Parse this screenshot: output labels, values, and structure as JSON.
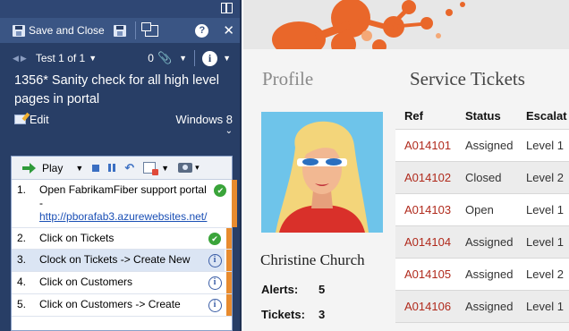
{
  "runner": {
    "toolbar": {
      "save_close_label": "Save and Close"
    },
    "nav": {
      "test_label": "Test 1 of 1",
      "attachment_count": "0"
    },
    "test_title": "1356* Sanity check for all high level pages in portal",
    "edit_label": "Edit",
    "configuration": "Windows 8",
    "play_label": "Play",
    "steps": [
      {
        "num": "1.",
        "text": "Open FabrikamFiber support portal  - ",
        "link": "http://pborafab3.azurewebsites.net/",
        "status": "passed",
        "selected": false
      },
      {
        "num": "2.",
        "text": "Click on Tickets",
        "status": "passed",
        "selected": false
      },
      {
        "num": "3.",
        "text": "Clock on Tickets -> Create New",
        "status": "info",
        "selected": true
      },
      {
        "num": "4.",
        "text": "Click on Customers",
        "status": "info",
        "selected": false
      },
      {
        "num": "5.",
        "text": "Click on Customers -> Create",
        "status": "info",
        "selected": false
      }
    ]
  },
  "web": {
    "profile_heading": "Profile",
    "person_name": "Christine Church",
    "stats": {
      "alerts_label": "Alerts:",
      "alerts_value": "5",
      "tickets_label": "Tickets:",
      "tickets_value": "3"
    },
    "tickets_heading": "Service Tickets",
    "columns": [
      "Ref",
      "Status",
      "Escalat"
    ],
    "rows": [
      [
        "A014101",
        "Assigned",
        "Level 1"
      ],
      [
        "A014102",
        "Closed",
        "Level 2"
      ],
      [
        "A014103",
        "Open",
        "Level 1"
      ],
      [
        "A014104",
        "Assigned",
        "Level 1"
      ],
      [
        "A014105",
        "Assigned",
        "Level 2"
      ],
      [
        "A014106",
        "Assigned",
        "Level 1"
      ]
    ]
  },
  "colors": {
    "runner_bg": "#283e66",
    "accent_orange": "#e88b2e",
    "ref_red": "#b02a1c",
    "pass_green": "#3aa43a"
  }
}
